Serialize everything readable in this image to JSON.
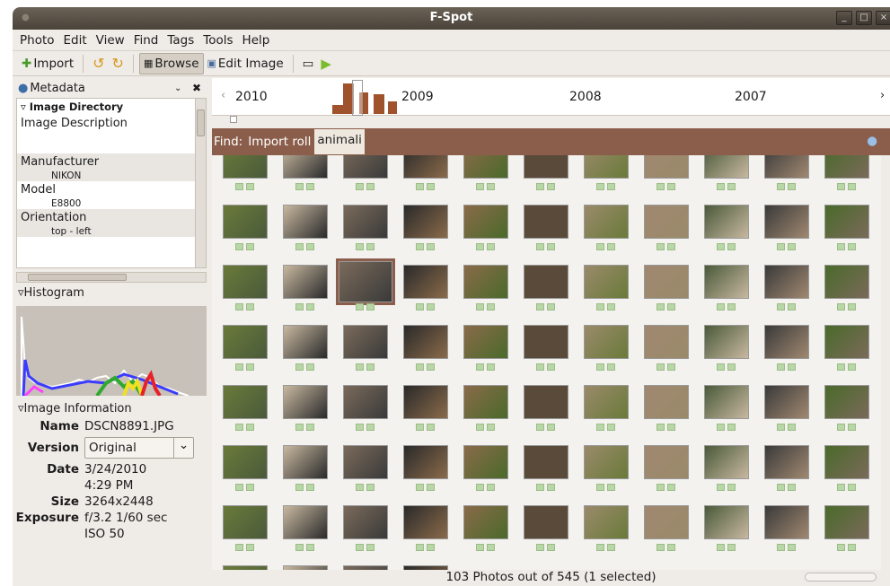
{
  "window": {
    "title": "F-Spot"
  },
  "menu": [
    "Photo",
    "Edit",
    "View",
    "Find",
    "Tags",
    "Tools",
    "Help"
  ],
  "toolbar": {
    "import": "Import",
    "browse": "Browse",
    "edit_image": "Edit Image"
  },
  "metadata": {
    "title": "Metadata",
    "section": "Image Directory",
    "rows": [
      {
        "label": "Image Description",
        "value": ""
      },
      {
        "label": "Manufacturer",
        "value": "NIKON"
      },
      {
        "label": "Model",
        "value": "E8800"
      },
      {
        "label": "Orientation",
        "value": "top - left"
      }
    ]
  },
  "histogram": {
    "title": "Histogram"
  },
  "image_info": {
    "title": "Image Information",
    "name_label": "Name",
    "name": "DSCN8891.JPG",
    "version_label": "Version",
    "version": "Original",
    "date_label": "Date",
    "date": "3/24/2010",
    "time": "4:29 PM",
    "size_label": "Size",
    "size": "3264x2448",
    "exposure_label": "Exposure",
    "exposure": "f/3.2 1/60 sec",
    "iso": "ISO 50"
  },
  "timeline": {
    "years": [
      "2010",
      "2009",
      "2008",
      "2007"
    ]
  },
  "find": {
    "label": "Find:",
    "import_roll": "Import roll",
    "query": "animali"
  },
  "status": "103 Photos out of 545 (1 selected)",
  "colors": {
    "titlebar": "#4a433a",
    "find_bg": "#8b5e4b",
    "accent": "#6b9c3c"
  }
}
